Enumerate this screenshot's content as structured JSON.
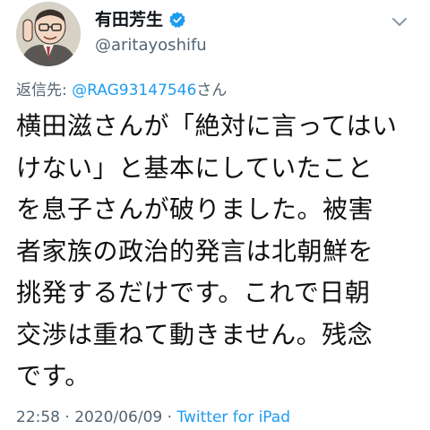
{
  "user": {
    "display_name": "有田芳生",
    "handle": "@aritayoshifu",
    "verified": true,
    "avatar_icon": "caricature-avatar",
    "more_icon": "chevron-down-icon"
  },
  "reply": {
    "prefix": "返信先:",
    "to_handle": "@RAG93147546",
    "suffix": "さん"
  },
  "tweet": {
    "lines": [
      "横田滋さんが「絶対に言ってはい",
      "けない」と基本にしていたこと",
      "を息子さんが破りました。被害",
      "者家族の政治的発言は北朝鮮を",
      "挑発するだけです。これで日朝",
      "交渉は重ねて動きません。残念",
      "です。"
    ]
  },
  "meta": {
    "time": "22:58",
    "sep1": " · ",
    "date": "2020/06/09",
    "sep2": " · ",
    "source": "Twitter for iPad"
  },
  "colors": {
    "link": "#1d9bf0",
    "secondary": "#536471",
    "text": "#111111"
  }
}
